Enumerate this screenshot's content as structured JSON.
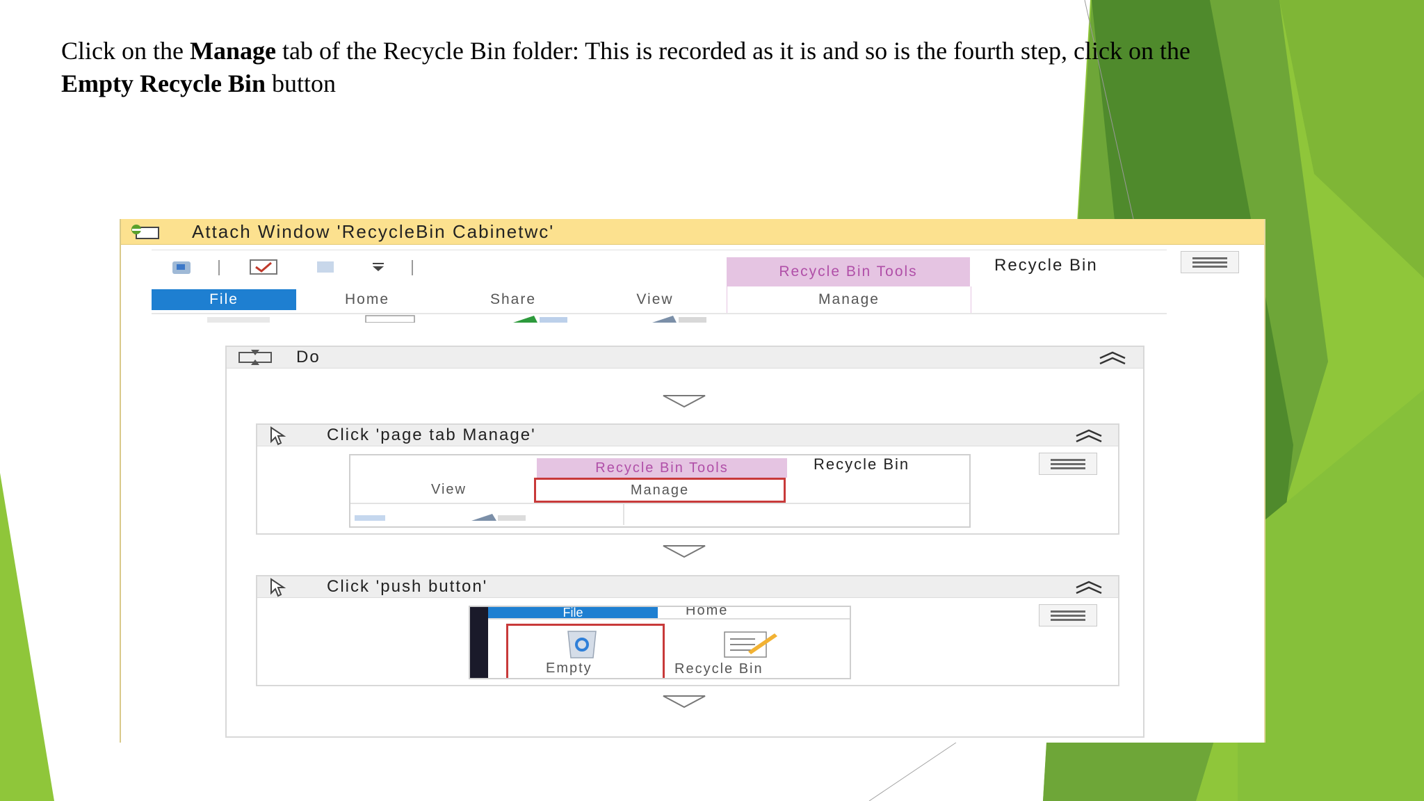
{
  "caption": {
    "part1": "Click on the ",
    "manage_bold": "Manage",
    "part2": " tab of the Recycle Bin folder: This is recorded as it is and so is the fourth step, click on the",
    "empty_bold": "Empty Recycle Bin",
    "part3": " button"
  },
  "window": {
    "title": "Attach Window 'RecycleBin Cabinetwc'",
    "tabs": {
      "file": "File",
      "home": "Home",
      "share": "Share",
      "view": "View"
    },
    "tools_header": "Recycle Bin Tools",
    "manage_tab": "Manage",
    "folder_title": "Recycle Bin"
  },
  "do_block": {
    "label": "Do"
  },
  "step1": {
    "label": "Click 'page tab  Manage'",
    "thumb": {
      "tools_header": "Recycle Bin Tools",
      "folder_title": "Recycle Bin",
      "view": "View",
      "manage": "Manage"
    }
  },
  "step2": {
    "label": "Click 'push button'",
    "thumb": {
      "file": "File",
      "home": "Home",
      "empty": "Empty",
      "recycle_bin": "Recycle Bin"
    }
  },
  "colors": {
    "title_bar": "#fce18f",
    "file_tab": "#1e7fd1",
    "tools_tab": "#e5c4e2",
    "highlight": "#c83a3a",
    "green_dark": "#4f8a2c",
    "green_light": "#8fc63a"
  }
}
